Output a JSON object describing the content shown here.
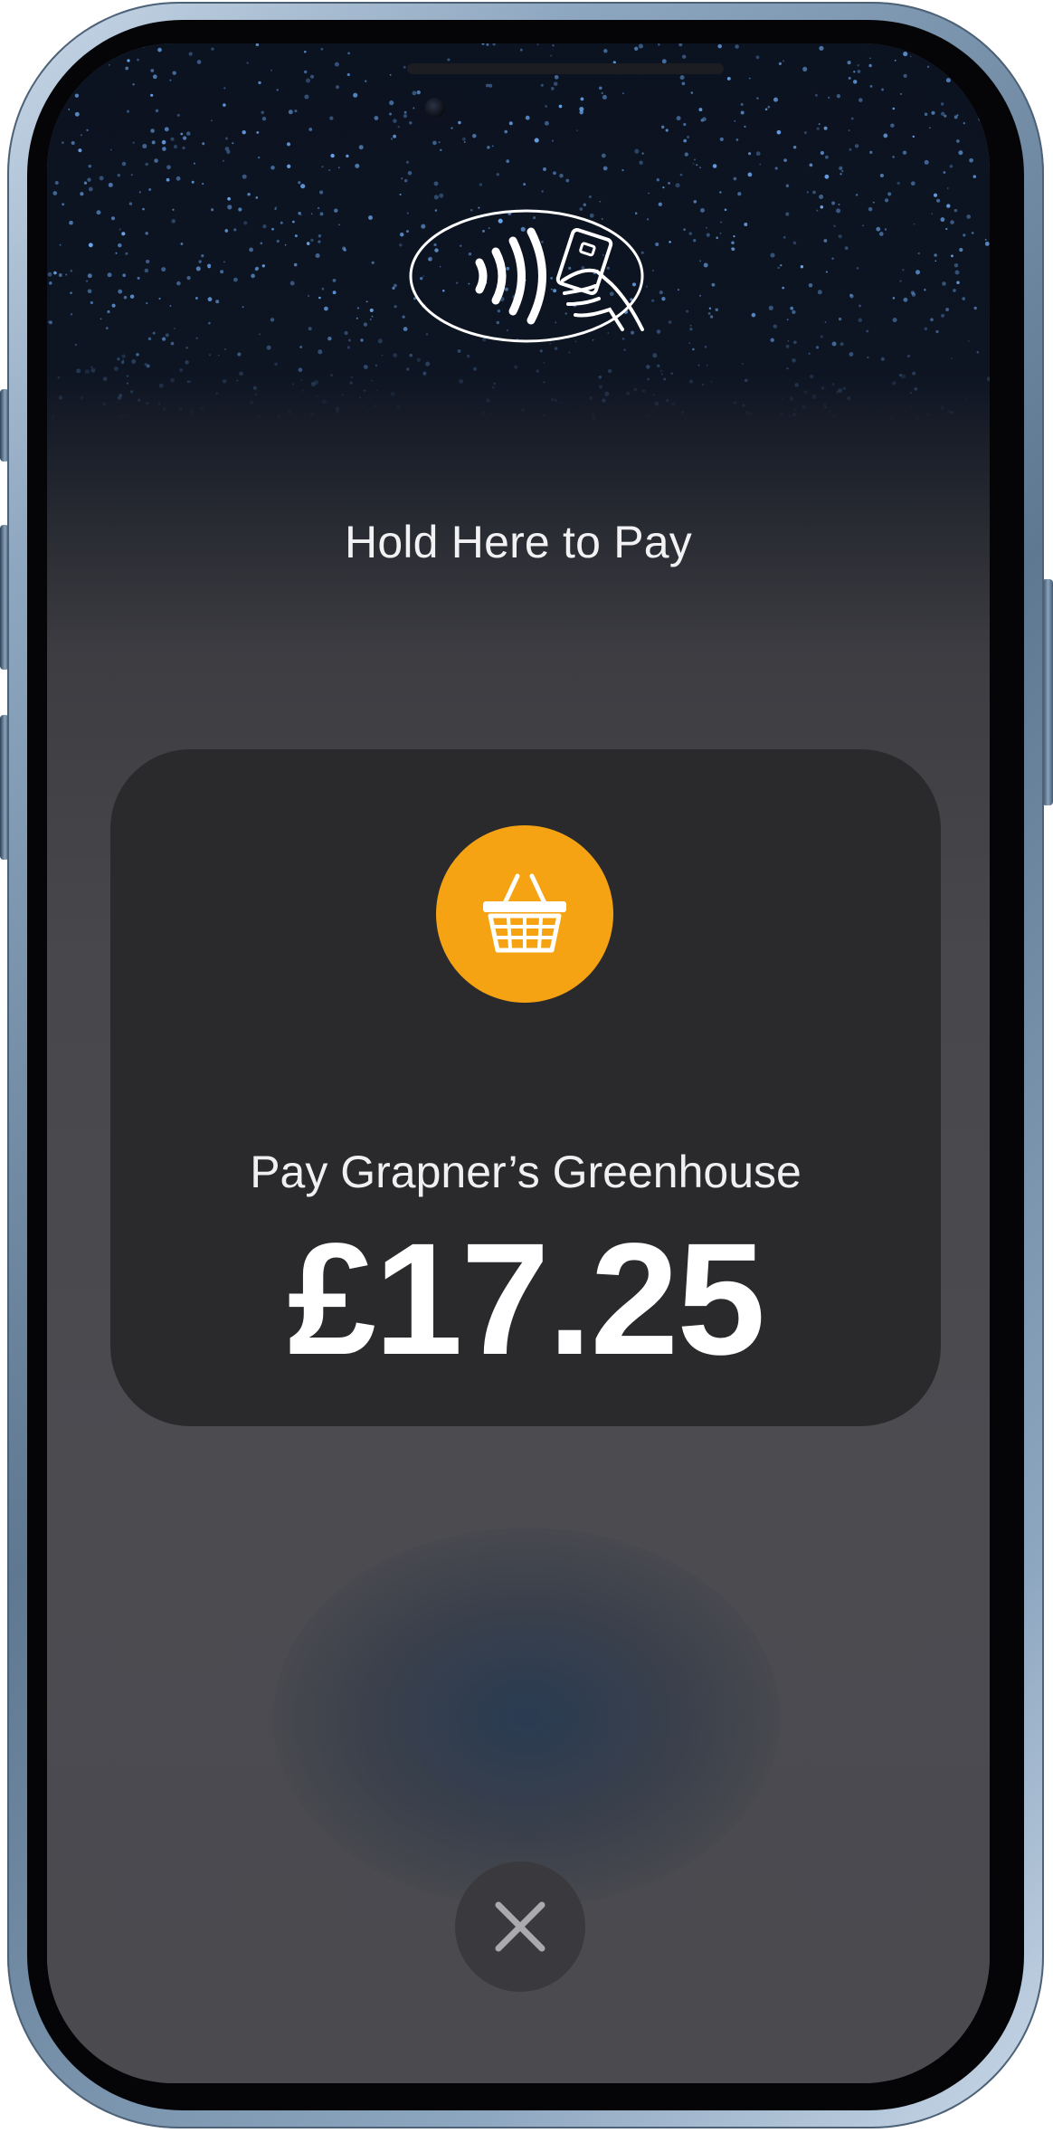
{
  "screen": {
    "instruction": "Hold Here to Pay",
    "nfc_icon": "contactless-card-tap-icon"
  },
  "payment_card": {
    "merchant_icon": "shopping-basket-icon",
    "merchant_label": "Pay Grapner’s Greenhouse",
    "amount": "£17.25"
  },
  "actions": {
    "cancel_icon": "close-icon"
  },
  "colors": {
    "merchant_icon_bg": "#f5a313",
    "card_bg": "#2a2a2d",
    "screen_bg": "#4a4a4f"
  }
}
